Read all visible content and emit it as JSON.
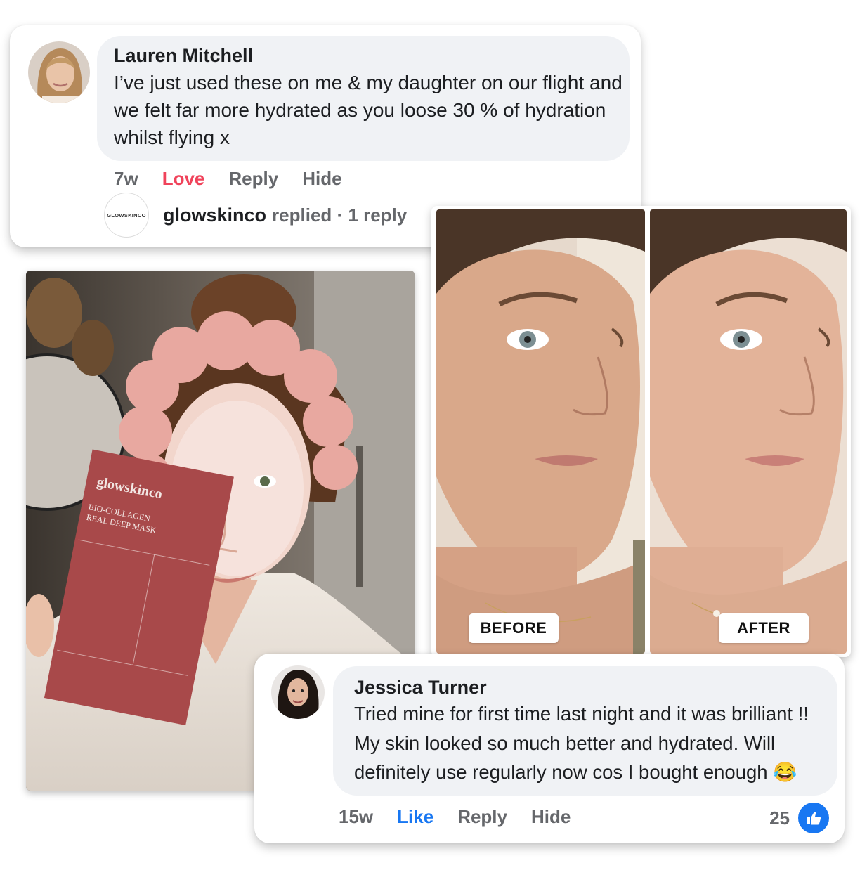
{
  "comments": [
    {
      "author": "Lauren Mitchell",
      "text": "I’ve just used these on me & my daughter on our flight and we felt far more hydrated as you loose 30 % of hydration whilst flying x",
      "time": "7w",
      "reaction_label": "Love",
      "reply_label": "Reply",
      "hide_label": "Hide",
      "reply_thread": {
        "brand_logo_text": "GLOWSKINCO",
        "brand": "glowskinco",
        "meta": "replied · 1 reply"
      }
    },
    {
      "author": "Jessica Turner",
      "text": "Tried mine for first time last night and it was brilliant !! My skin looked so much better and hydrated. Will definitely use regularly now cos I bought enough 😂",
      "time": "15w",
      "reaction_label": "Like",
      "reply_label": "Reply",
      "hide_label": "Hide",
      "like_count": "25"
    }
  ],
  "product": {
    "brand": "glowskinco",
    "line1": "BIO-COLLAGEN",
    "line2": "REAL DEEP MASK"
  },
  "comparison": {
    "before_label": "BEFORE",
    "after_label": "AFTER"
  },
  "colors": {
    "love": "#f0435b",
    "like": "#1877f2",
    "bubble": "#f0f2f5",
    "packet": "#a8494a",
    "headband": "#e8a8a0"
  }
}
